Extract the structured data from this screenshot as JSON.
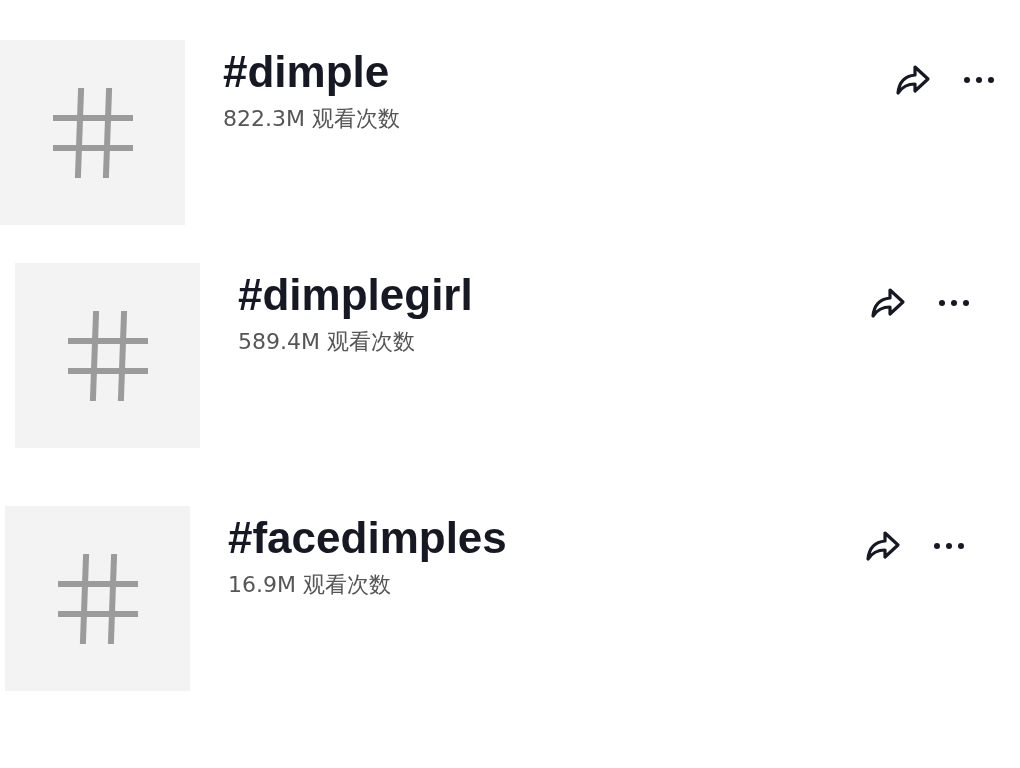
{
  "hashtags": [
    {
      "name": "#dimple",
      "views": "822.3M 观看次数"
    },
    {
      "name": "#dimplegirl",
      "views": "589.4M 观看次数"
    },
    {
      "name": "#facedimples",
      "views": "16.9M 观看次数"
    }
  ]
}
